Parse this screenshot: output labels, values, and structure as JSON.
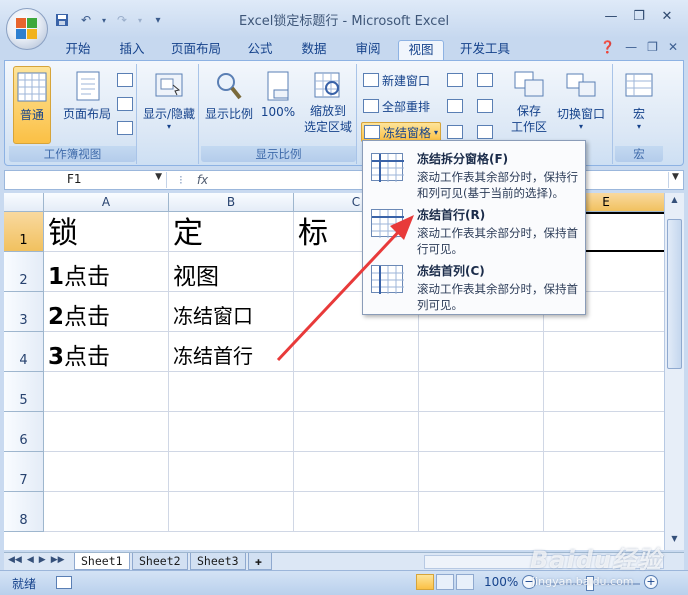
{
  "window": {
    "title": "Excel锁定标题行 - Microsoft Excel",
    "qat_more": "▾"
  },
  "tabs": [
    {
      "label": "开始"
    },
    {
      "label": "插入"
    },
    {
      "label": "页面布局"
    },
    {
      "label": "公式"
    },
    {
      "label": "数据"
    },
    {
      "label": "审阅"
    },
    {
      "label": "视图"
    },
    {
      "label": "开发工具"
    }
  ],
  "ribbon": {
    "group_workbook_views": {
      "label": "工作簿视图",
      "normal": "普通",
      "page_layout": "页面布局"
    },
    "group_show_hide": {
      "label": "显示/隐藏"
    },
    "group_zoom": {
      "label": "显示比例",
      "zoom": "显示比例",
      "hundred": "100%",
      "zoom_to_selection_1": "缩放到",
      "zoom_to_selection_2": "选定区域"
    },
    "group_window": {
      "new_window": "新建窗口",
      "arrange_all": "全部重排",
      "freeze_panes": "冻结窗格",
      "save_workspace_1": "保存",
      "save_workspace_2": "工作区",
      "switch_windows": "切换窗口"
    },
    "group_macros": {
      "label": "宏",
      "macros": "宏"
    }
  },
  "formula_bar": {
    "name_box": "F1",
    "fx": "fx"
  },
  "columns": [
    "A",
    "B",
    "C",
    "D",
    "E"
  ],
  "rows": [
    "1",
    "2",
    "3",
    "4",
    "5",
    "6",
    "7",
    "8"
  ],
  "cells": {
    "A1": "锁",
    "B1": "定",
    "C1": "标",
    "A2_num": "1",
    "A2_txt": "点击",
    "B2": "视图",
    "A3_num": "2",
    "A3_txt": "点击",
    "B3": "冻结窗口",
    "A4_num": "3",
    "A4_txt": "点击",
    "B4": "冻结首行"
  },
  "freeze_menu": {
    "items": [
      {
        "title": "冻结拆分窗格(F)",
        "desc": "滚动工作表其余部分时，保持行和列可见(基于当前的选择)。"
      },
      {
        "title": "冻结首行(R)",
        "desc": "滚动工作表其余部分时，保持首行可见。"
      },
      {
        "title": "冻结首列(C)",
        "desc": "滚动工作表其余部分时，保持首列可见。"
      }
    ]
  },
  "sheet_tabs": [
    "Sheet1",
    "Sheet2",
    "Sheet3"
  ],
  "status": {
    "ready": "就绪",
    "zoom": "100%"
  },
  "watermark": {
    "brand": "Baidu经验",
    "url": "jingyan.baidu.com"
  },
  "colors": {
    "accent_active": "#fbc045",
    "ribbon_blue": "#15428b",
    "arrow_red": "#e83a3a"
  }
}
